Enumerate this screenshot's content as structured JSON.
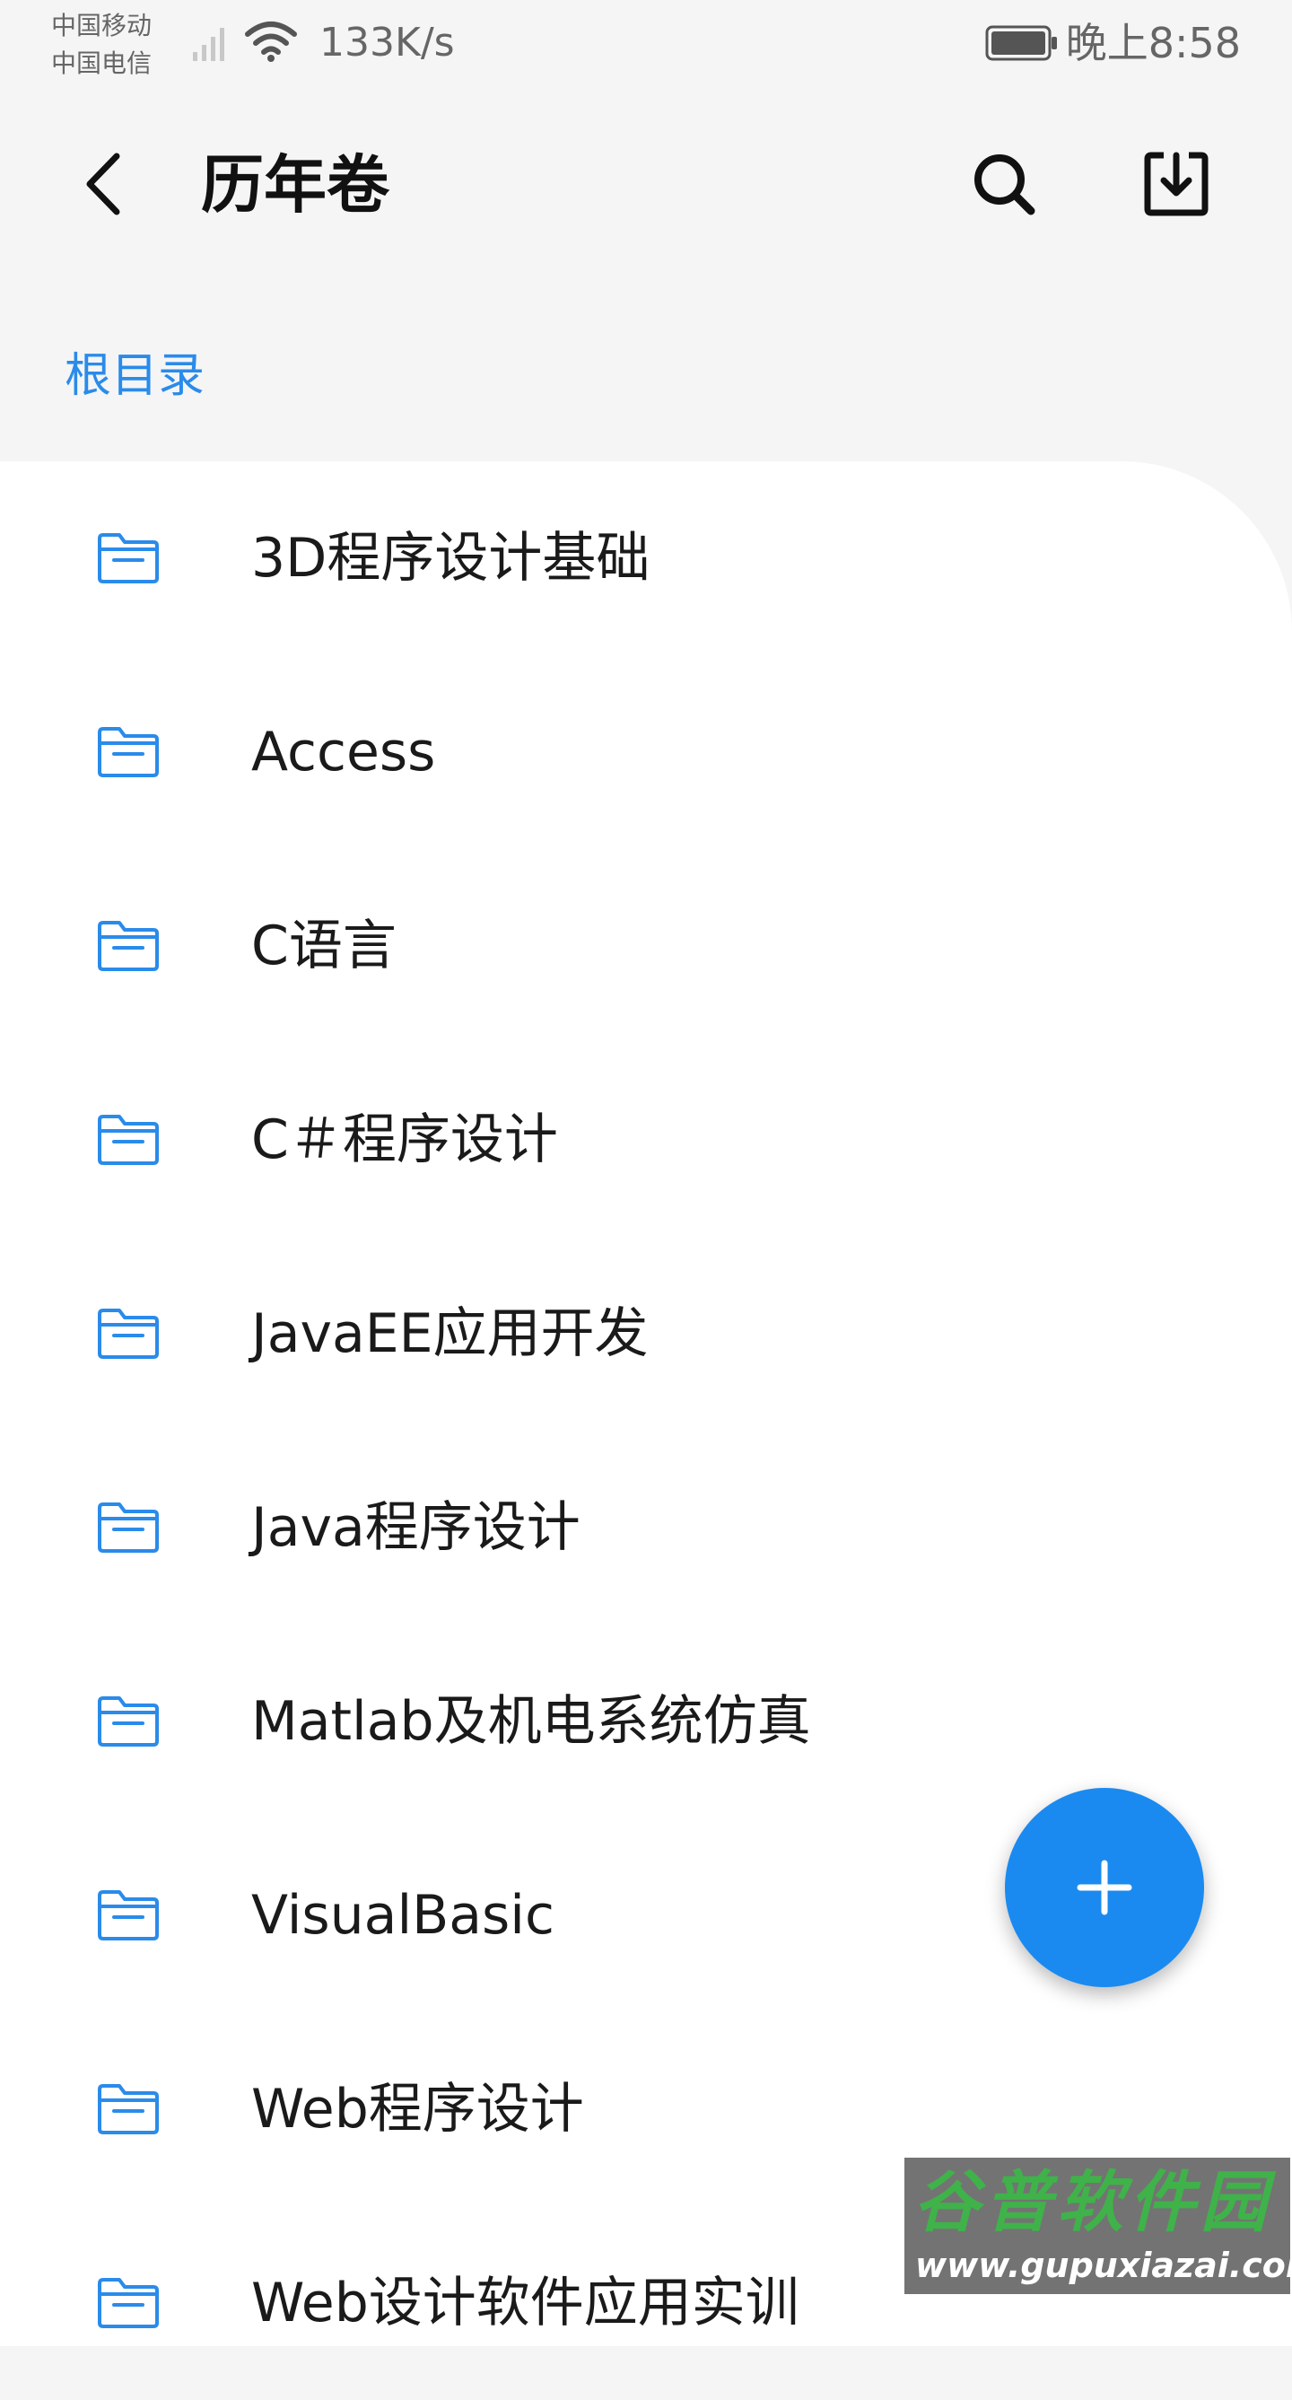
{
  "status_bar": {
    "carrier_1": "中国移动",
    "carrier_2": "中国电信",
    "net_speed": "133K/s",
    "time": "晚上8:58"
  },
  "app_bar": {
    "title": "历年卷",
    "back_icon": "chevron-left-icon",
    "search_icon": "search-icon",
    "download_icon": "download-icon"
  },
  "breadcrumb": {
    "root": "根目录"
  },
  "folders": [
    {
      "label": "3D程序设计基础",
      "icon": "folder-icon"
    },
    {
      "label": "Access",
      "icon": "folder-icon"
    },
    {
      "label": "C语言",
      "icon": "folder-icon"
    },
    {
      "label": "C＃程序设计",
      "icon": "folder-icon"
    },
    {
      "label": "JavaEE应用开发",
      "icon": "folder-icon"
    },
    {
      "label": "Java程序设计",
      "icon": "folder-icon"
    },
    {
      "label": "Matlab及机电系统仿真",
      "icon": "folder-icon"
    },
    {
      "label": "VisualBasic",
      "icon": "folder-icon"
    },
    {
      "label": "Web程序设计",
      "icon": "folder-icon"
    },
    {
      "label": "Web设计软件应用实训",
      "icon": "folder-icon"
    }
  ],
  "fab": {
    "icon": "plus-icon"
  },
  "watermark": {
    "title": "谷普软件园",
    "url": "www.gupuxiazai.com"
  },
  "colors": {
    "accent": "#1a8af0",
    "breadcrumb": "#2a8bea",
    "folder_icon": "#2a8bea",
    "background": "#f5f5f5",
    "card": "#ffffff"
  }
}
